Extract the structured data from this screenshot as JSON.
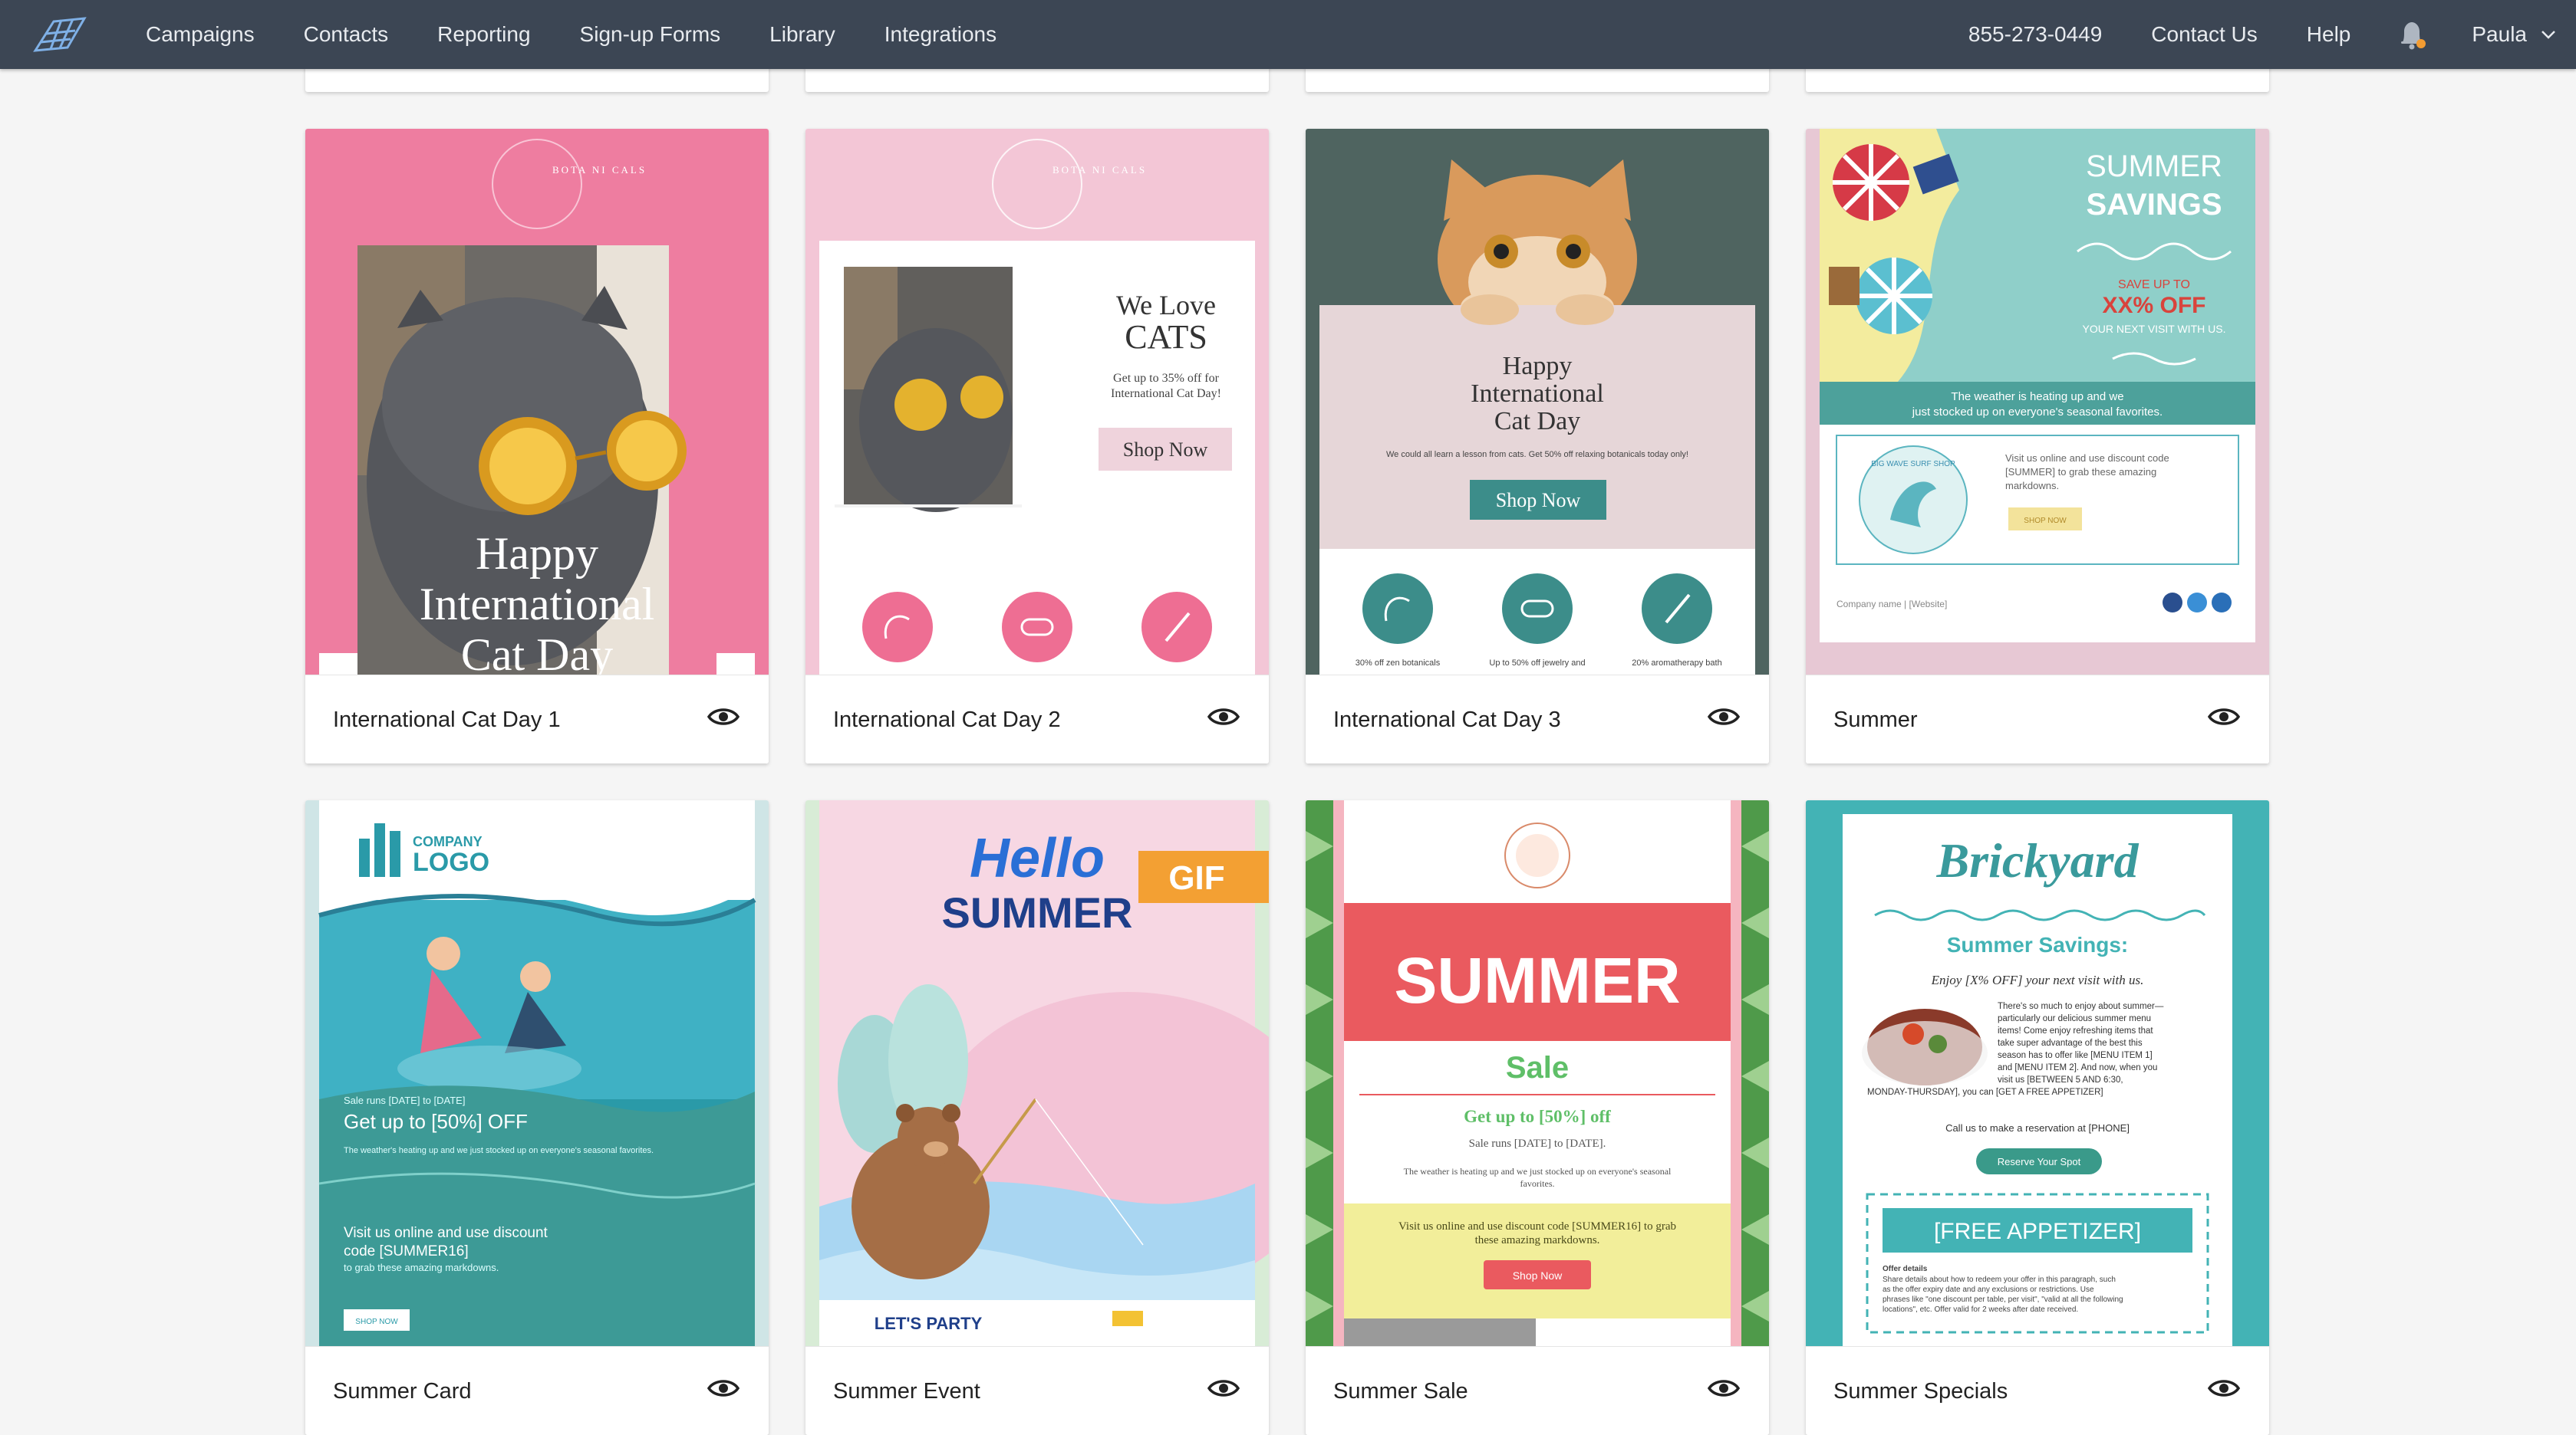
{
  "nav": {
    "left": [
      "Campaigns",
      "Contacts",
      "Reporting",
      "Sign-up Forms",
      "Library",
      "Integrations"
    ],
    "phone": "855-273-0449",
    "contact_us": "Contact Us",
    "help": "Help",
    "user": "Paula"
  },
  "cards": [
    {
      "title": "International Cat Day 1",
      "thumb": {
        "headline_1": "Happy",
        "headline_2": "International",
        "headline_3": "Cat Day",
        "brand": "BOTA NI CALS"
      }
    },
    {
      "title": "International Cat Day 2",
      "thumb": {
        "brand": "BOTA NI CALS",
        "heading_1": "We Love",
        "heading_2": "CATS",
        "sub_1": "Get up to 35% off for",
        "sub_2": "International Cat Day!",
        "button": "Shop Now"
      }
    },
    {
      "title": "International Cat Day 3",
      "thumb": {
        "heading_1": "Happy",
        "heading_2": "International",
        "heading_3": "Cat Day",
        "body": "We could all learn a lesson from cats. Get 50% off relaxing botanicals today only!",
        "button": "Shop Now",
        "cap_1": "30% off zen botanicals",
        "cap_2": "Up to 50% off jewelry and",
        "cap_3": "20% aromatherapy bath"
      }
    },
    {
      "title": "Summer",
      "thumb": {
        "heading_1": "SUMMER",
        "heading_2": "SAVINGS",
        "save": "SAVE UP TO",
        "off": "XX% OFF",
        "next": "YOUR NEXT VISIT WITH US.",
        "band_1": "The weather is heating up and we",
        "band_2": "just stocked up on everyone's seasonal favorites.",
        "shop": "BIG WAVE SURF SHOP",
        "copy_1": "Visit us online and use discount code",
        "copy_2": "[SUMMER] to grab these amazing",
        "copy_3": "markdowns.",
        "button": "SHOP NOW",
        "footer": "Company name | [Website]"
      }
    },
    {
      "title": "Summer Card",
      "thumb": {
        "logo_1": "COMPANY",
        "logo_2": "LOGO",
        "small": "Sale runs [DATE] to [DATE]",
        "headline": "Get up to [50%] OFF",
        "sub": "The weather's heating up and we just stocked up on everyone's seasonal favorites.",
        "visit_1": "Visit us online and use discount",
        "visit_2": "code [SUMMER16]",
        "visit_3": "to grab these amazing markdowns.",
        "button": "SHOP NOW"
      }
    },
    {
      "title": "Summer Event",
      "thumb": {
        "hello": "Hello",
        "summer": "SUMMER",
        "gif": "GIF",
        "party": "LET'S PARTY"
      }
    },
    {
      "title": "Summer Sale",
      "thumb": {
        "big": "SUMMER",
        "sale": "Sale",
        "offer": "Get up to [50%] off",
        "dates": "Sale runs [DATE] to [DATE].",
        "weather_1": "The weather is heating up and we just stocked up on everyone's seasonal",
        "weather_2": "favorites.",
        "visit_1": "Visit us online and use discount code [SUMMER16] to grab",
        "visit_2": "these amazing markdowns.",
        "button": "Shop Now"
      }
    },
    {
      "title": "Summer Specials",
      "thumb": {
        "brand": "Brickyard",
        "heading": "Summer Savings:",
        "enjoy": "Enjoy [X% OFF] your next visit with us.",
        "body_1": "There's so much to enjoy about summer—",
        "body_2": "particularly our delicious summer menu",
        "body_3": "items! Come enjoy refreshing items that",
        "body_4": "take super advantage of the best this",
        "body_5": "season has to offer like [MENU ITEM 1]",
        "body_6": "and [MENU ITEM 2]. And now, when you",
        "body_7": "visit us [BETWEEN 5 AND 6:30,",
        "body_8": "MONDAY-THURSDAY], you can [GET A FREE APPETIZER]",
        "call": "Call us to make a reservation at [PHONE]",
        "button": "Reserve Your Spot",
        "coupon": "[FREE APPETIZER]",
        "offer_title": "Offer details",
        "offer_1": "Share details about how to redeem your offer in this paragraph, such",
        "offer_2": "as the offer expiry date and any exclusions or restrictions. Use",
        "offer_3": "phrases like \"one discount per table, per visit\", \"valid at all the following",
        "offer_4": "locations\", etc. Offer valid for 2 weeks after date received."
      }
    }
  ],
  "colors": {
    "nav_bg": "#3c4654",
    "cat1_pink": "#ee7da0",
    "cat2_pink": "#f3c6d6",
    "teal": "#3c8d8a",
    "summer_teal": "#8fcfc9",
    "sale_red": "#ea5a5f",
    "specials_teal": "#43b3b5"
  },
  "icons": [
    "logo-mark",
    "bell-icon",
    "chevron-down-icon",
    "eye-icon"
  ]
}
